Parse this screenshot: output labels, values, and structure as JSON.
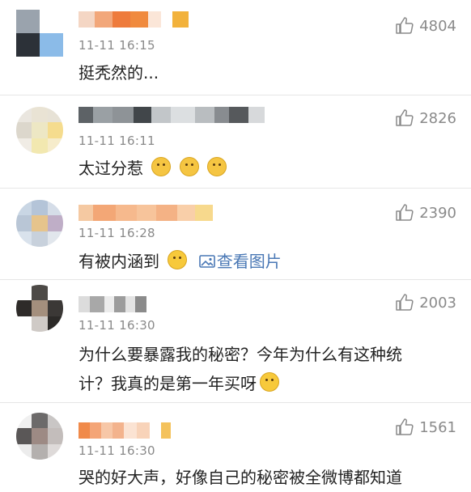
{
  "comments": [
    {
      "time": "11-11 16:15",
      "text": "挺秃然的...",
      "likes": "4804"
    },
    {
      "time": "11-11 16:11",
      "text": "太过分惹",
      "likes": "2826"
    },
    {
      "time": "11-11 16:28",
      "text": "有被内涵到",
      "likes": "2390",
      "image_link": "查看图片"
    },
    {
      "time": "11-11 16:30",
      "text1": "为什么要暴露我的秘密？今年为什么有这种统",
      "text2": "计？我真的是第一年买呀",
      "likes": "2003"
    },
    {
      "time": "11-11 16:30",
      "text": "哭的好大声，好像自己的秘密被全微博都知道",
      "likes": "1561"
    }
  ]
}
